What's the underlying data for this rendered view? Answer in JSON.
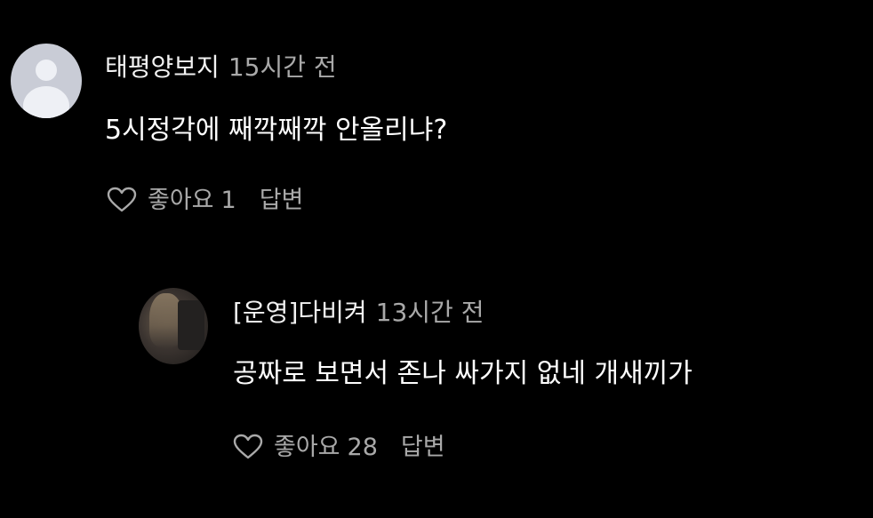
{
  "comments": [
    {
      "username": "태평양보지",
      "time": "15시간 전",
      "text": "5시정각에 째깍째깍 안올리냐?",
      "like_label": "좋아요",
      "like_count": "1",
      "reply_label": "답변"
    }
  ],
  "reply": {
    "username": "[운영]다비켜",
    "time": "13시간 전",
    "text": "공짜로 보면서 존나 싸가지 없네 개새끼가",
    "like_label": "좋아요",
    "like_count": "28",
    "reply_label": "답변"
  },
  "icons": {
    "like": "heart-outline-icon",
    "avatar_default": "default-user-avatar",
    "avatar_photo": "user-photo-avatar"
  },
  "colors": {
    "background": "#000000",
    "text_primary": "#ffffff",
    "text_secondary": "#a9a9a9"
  }
}
